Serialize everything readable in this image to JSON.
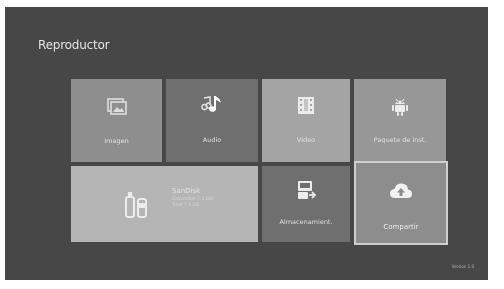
{
  "screen": {
    "title": "Reproductor",
    "version": "Version 1.0"
  },
  "tiles": [
    {
      "label": "Imagen",
      "icon": "image-icon"
    },
    {
      "label": "Audio",
      "icon": "music-note-icon"
    },
    {
      "label": "Video",
      "icon": "film-icon"
    },
    {
      "label": "Paquete de inst.",
      "icon": "android-icon"
    },
    {
      "label": "SanDisk",
      "icon": "usb-storage-icon",
      "info_line1": "Disponible 7.3 GB/",
      "info_line2": "Total 7.4 GB"
    },
    {
      "label": "Almacenamient.",
      "icon": "storage-transfer-icon"
    },
    {
      "label": "Compartir",
      "icon": "cloud-upload-icon"
    }
  ],
  "colors": {
    "background": "#474747",
    "text": "#e6e6e6",
    "focus_border": "#cfcfcf"
  }
}
